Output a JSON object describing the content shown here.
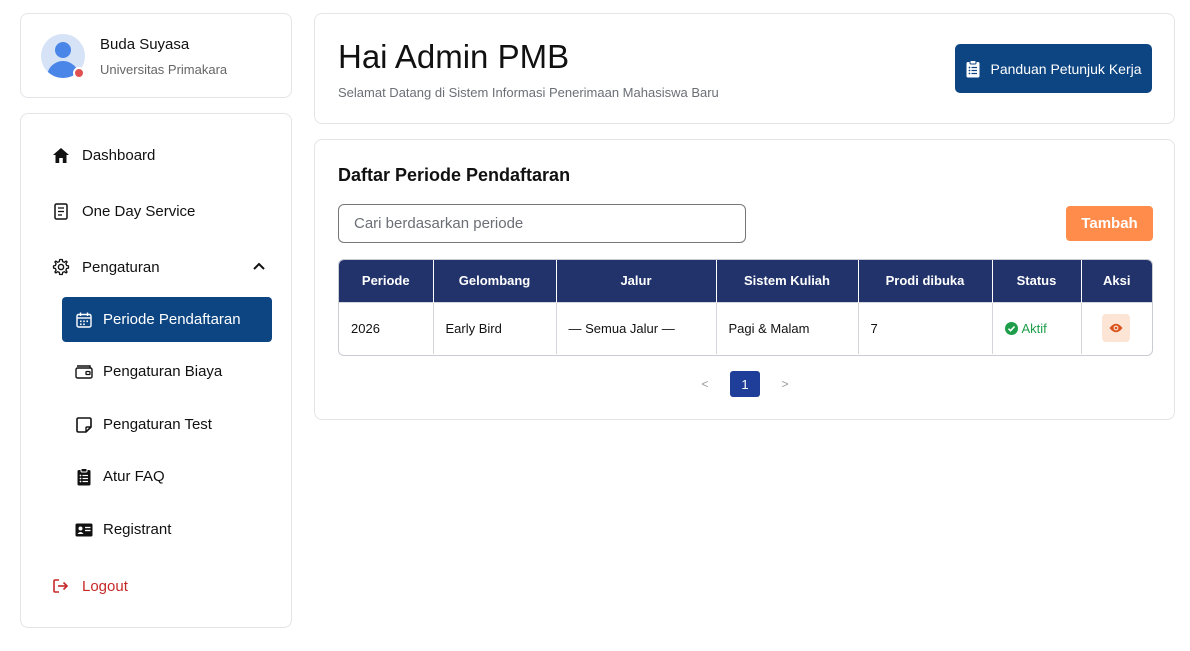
{
  "profile": {
    "name": "Buda Suyasa",
    "organization": "Universitas Primakara"
  },
  "sidebar": {
    "items": [
      {
        "label": "Dashboard",
        "icon": "home-icon"
      },
      {
        "label": "One Day Service",
        "icon": "document-icon"
      },
      {
        "label": "Pengaturan",
        "icon": "gear-icon",
        "expanded": true
      }
    ],
    "sub_items": [
      {
        "label": "Periode Pendaftaran",
        "icon": "calendar-icon",
        "active": true
      },
      {
        "label": "Pengaturan Biaya",
        "icon": "wallet-icon"
      },
      {
        "label": "Pengaturan Test",
        "icon": "note-icon"
      },
      {
        "label": "Atur FAQ",
        "icon": "clipboard-icon"
      },
      {
        "label": "Registrant",
        "icon": "id-card-icon"
      }
    ],
    "logout_label": "Logout"
  },
  "header": {
    "title": "Hai Admin PMB",
    "subtitle": "Selamat Datang di Sistem Informasi Penerimaan Mahasiswa Baru",
    "guide_button": "Panduan Petunjuk Kerja"
  },
  "main": {
    "title": "Daftar Periode Pendaftaran",
    "search_placeholder": "Cari berdasarkan periode",
    "add_button": "Tambah",
    "table": {
      "columns": [
        "Periode",
        "Gelombang",
        "Jalur",
        "Sistem Kuliah",
        "Prodi dibuka",
        "Status",
        "Aksi"
      ],
      "rows": [
        {
          "periode": "2026",
          "gelombang": "Early Bird",
          "jalur": "— Semua Jalur —",
          "sistem_kuliah": "Pagi & Malam",
          "prodi_dibuka": "7",
          "status": "Aktif"
        }
      ]
    },
    "pagination": {
      "prev": "<",
      "current": "1",
      "next": ">"
    }
  },
  "colors": {
    "primary": "#0d4582",
    "table_header": "#22336b",
    "accent_orange": "#ff8c4a",
    "status_active": "#1e9e4a",
    "logout": "#c62828"
  }
}
